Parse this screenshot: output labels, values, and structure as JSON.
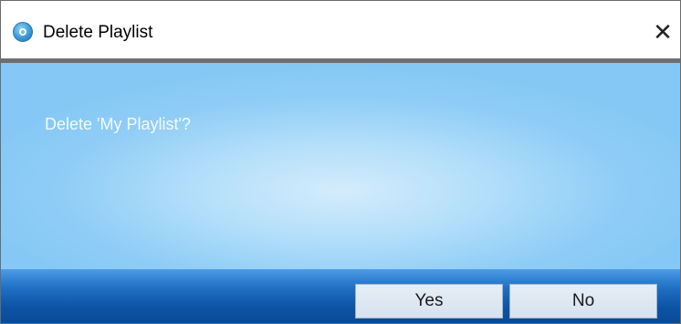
{
  "window": {
    "title": "Delete Playlist",
    "close_glyph": "✕",
    "app_icon": "app-logo-icon"
  },
  "dialog": {
    "message": "Delete 'My Playlist'?"
  },
  "buttons": {
    "yes_label": "Yes",
    "no_label": "No"
  },
  "colors": {
    "content_background": "#a8d8f8",
    "button_bar": "#1260b5",
    "message_text": "#f3f9ff"
  }
}
